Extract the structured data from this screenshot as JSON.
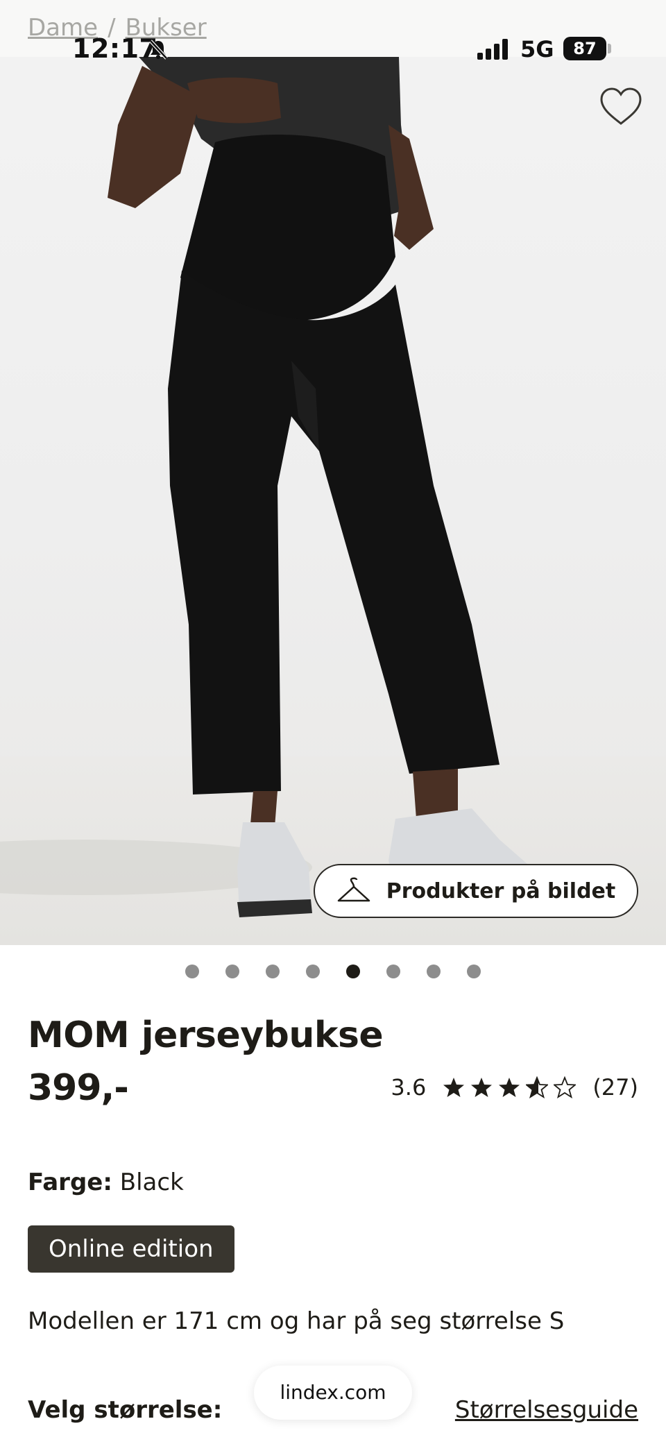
{
  "status_bar": {
    "time": "12:17",
    "network": "5G",
    "battery": "87"
  },
  "breadcrumb": [
    "Dame",
    "/",
    "Bukser"
  ],
  "image": {
    "wishlist_icon": "heart-outline-icon",
    "products_button_label": "Produkter på bildet",
    "products_button_icon": "hanger-icon"
  },
  "carousel": {
    "total": 8,
    "active_index": 4
  },
  "product": {
    "title": "MOM jerseybukse",
    "price": "399,-",
    "rating_value": "3.6",
    "rating_stars": 3.6,
    "rating_count": "(27)"
  },
  "color": {
    "label": "Farge:",
    "value": "Black"
  },
  "badge": "Online edition",
  "model_info": "Modellen er 171 cm og har på seg størrelse S",
  "size": {
    "label": "Velg størrelse:",
    "guide_link": "Størrelsesguide"
  },
  "browser": {
    "url": "lindex.com"
  },
  "colors": {
    "text": "#1e1c17",
    "badge_bg": "#39362f",
    "dot_inactive": "#8d8d8d",
    "dot_active": "#1e1c17"
  }
}
